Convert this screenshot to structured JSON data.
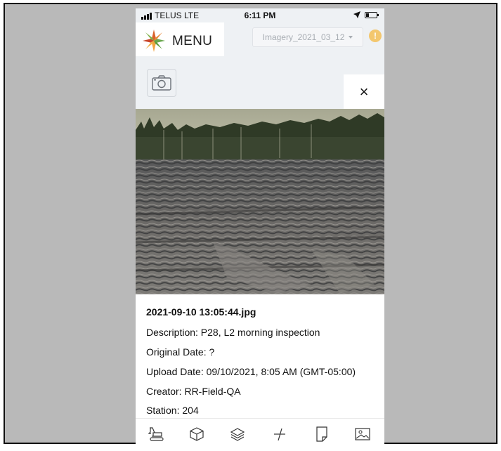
{
  "status_bar": {
    "carrier": "TELUS  LTE",
    "time": "6:11 PM"
  },
  "header": {
    "menu_label": "MENU",
    "imagery_select": "Imagery_2021_03_12",
    "alert_badge": "!"
  },
  "close_label": "×",
  "photo_details": {
    "filename": "2021-09-10 13:05:44.jpg",
    "description": "Description: P28, L2 morning inspection",
    "original_date": "Original Date: ?",
    "upload_date": "Upload Date: 09/10/2021, 8:05 AM (GMT-05:00)",
    "creator": "Creator: RR-Field-QA",
    "station": "Station: 204"
  },
  "toolbar": {
    "icons": [
      "excavator-icon",
      "cube-icon",
      "layers-icon",
      "measure-icon",
      "note-icon",
      "image-icon"
    ]
  },
  "colors": {
    "background": "#b9b9b9",
    "app_background": "#eef1f4",
    "badge": "#f3c76e"
  }
}
